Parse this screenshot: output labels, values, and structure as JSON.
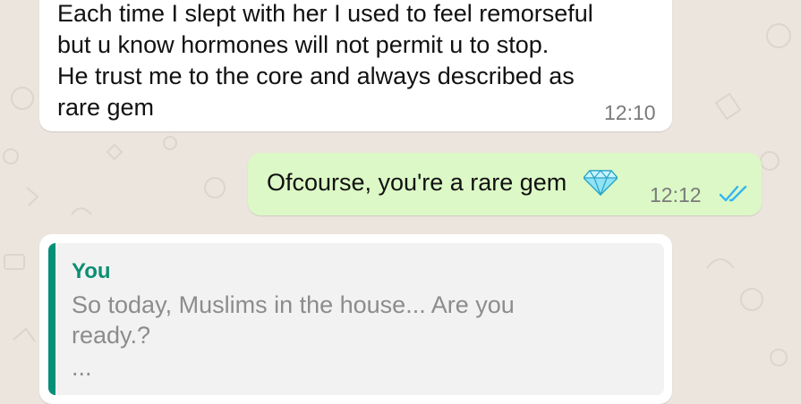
{
  "theme": {
    "chat_background": "#ece5dd",
    "incoming_bubble": "#ffffff",
    "outgoing_bubble": "#dcf8c6",
    "quote_accent": "#068f79",
    "read_ticks": "#34b7f1"
  },
  "messages": [
    {
      "direction": "incoming",
      "text": "Each time I slept with her I used to feel remorseful\nbut u know hormones will not permit u to stop.\nHe trust me to the core and always described as\nrare gem",
      "time": "12:10"
    },
    {
      "direction": "outgoing",
      "text": "Ofcourse, you're a rare gem",
      "emoji": "gem-stone-icon",
      "time": "12:12",
      "status": "read-double-ticks"
    },
    {
      "direction": "incoming",
      "quoted": {
        "author": "You",
        "text": "So today, Muslims in the house... Are you\nready.?",
        "more": "..."
      }
    }
  ]
}
